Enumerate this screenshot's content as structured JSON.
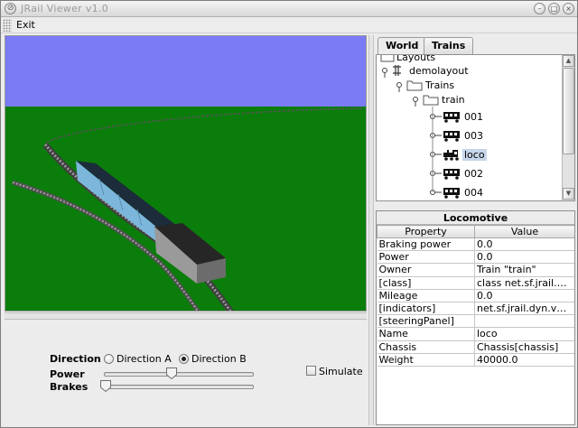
{
  "window": {
    "title": "JRail Viewer v1.0"
  },
  "menu": {
    "exit_label": "Exit"
  },
  "controls": {
    "direction_label": "Direction",
    "direction_a_label": "Direction A",
    "direction_b_label": "Direction B",
    "direction_selected": "Direction B",
    "power_label": "Power",
    "power_value": 0.45,
    "brakes_label": "Brakes",
    "brakes_value": 0.0,
    "simulate_label": "Simulate",
    "simulate_checked": false
  },
  "tabs": [
    {
      "label": "World",
      "active": true
    },
    {
      "label": "Trains",
      "active": false
    }
  ],
  "tree": {
    "nodes": [
      {
        "label": "Layouts",
        "icon": "folder-icon"
      },
      {
        "label": "demolayout",
        "icon": "layout-icon"
      },
      {
        "label": "Trains",
        "icon": "folder-icon"
      },
      {
        "label": "train",
        "icon": "folder-icon"
      },
      {
        "label": "001",
        "icon": "wagon-icon"
      },
      {
        "label": "003",
        "icon": "wagon-icon"
      },
      {
        "label": "loco",
        "icon": "locomotive-icon",
        "selected": true
      },
      {
        "label": "002",
        "icon": "wagon-icon"
      },
      {
        "label": "004",
        "icon": "wagon-icon"
      }
    ]
  },
  "properties": {
    "caption": "Locomotive",
    "columns": [
      "Property",
      "Value"
    ],
    "rows": [
      [
        "Braking power",
        "0.0"
      ],
      [
        "Power",
        "0.0"
      ],
      [
        "Owner",
        "Train \"train\""
      ],
      [
        "[class]",
        "class net.sf.jrail.dy..."
      ],
      [
        "Mileage",
        "0.0"
      ],
      [
        "[indicators]",
        "net.sf.jrail.dyn.veh..."
      ],
      [
        "[steeringPanel]",
        ""
      ],
      [
        "Name",
        "loco"
      ],
      [
        "Chassis",
        "Chassis[chassis]"
      ],
      [
        "Weight",
        "40000.0"
      ]
    ]
  },
  "colors": {
    "sky": "#7b7bf5",
    "ground": "#0b7d0b",
    "selection": "#c6d5e9"
  }
}
